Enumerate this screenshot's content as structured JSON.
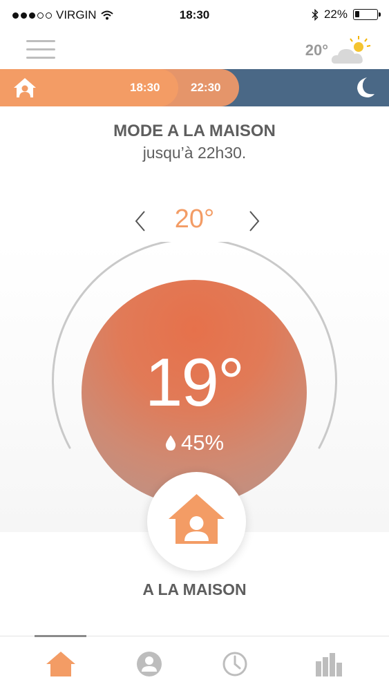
{
  "status_bar": {
    "carrier": "VIRGIN",
    "time": "18:30",
    "battery_percent": "22%",
    "battery_level": 0.22,
    "icons": [
      "signal-dots-icon",
      "wifi-icon",
      "bluetooth-icon",
      "battery-icon"
    ]
  },
  "header": {
    "menu_icon": "hamburger-menu-icon",
    "weather_temp": "20°",
    "weather_icon": "partly-cloudy-icon"
  },
  "timeline": {
    "current_icon": "home-icon",
    "start_time": "18:30",
    "end_time": "22:30",
    "next_icon": "moon-icon",
    "colors": {
      "home": "#f39c65",
      "home_later": "#e5956a",
      "night": "#4a6886"
    }
  },
  "mode": {
    "title": "MODE A LA MAISON",
    "until": "jusqu’à 22h30."
  },
  "setpoint": {
    "value": "20°",
    "prev_icon": "chevron-left-icon",
    "next_icon": "chevron-right-icon"
  },
  "dial": {
    "current_temp": "19°",
    "humidity": "45%",
    "humidity_icon": "water-drop-icon"
  },
  "mode_button": {
    "icon": "home-person-icon",
    "label": "A LA MAISON"
  },
  "tabbar": {
    "tabs": [
      {
        "name": "home",
        "icon": "home-icon",
        "active": true
      },
      {
        "name": "profile",
        "icon": "person-icon",
        "active": false
      },
      {
        "name": "schedule",
        "icon": "clock-icon",
        "active": false
      },
      {
        "name": "statistics",
        "icon": "bar-chart-icon",
        "active": false
      }
    ]
  },
  "colors": {
    "accent": "#f39c65",
    "text": "#5e5e5e",
    "night": "#4a6886",
    "inactive_icon": "#bdbdbd"
  }
}
